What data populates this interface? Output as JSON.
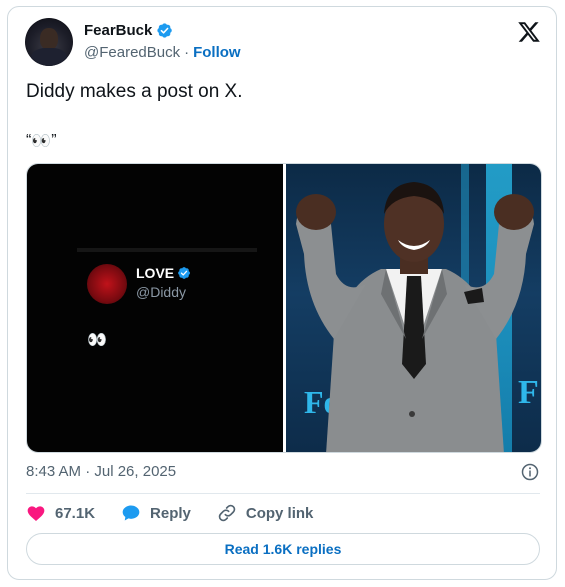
{
  "author": {
    "name": "FearBuck",
    "handle": "@FearedBuck",
    "separator": "·",
    "follow_label": "Follow"
  },
  "tweet": {
    "text": "Diddy makes a post on X.",
    "quote_open": "“",
    "quote_emoji": "👀",
    "quote_close": "”"
  },
  "media": {
    "left_panel": {
      "display_name": "LOVE",
      "handle": "@Diddy",
      "emoji": "👀"
    },
    "right_panel": {
      "stage_text_left": "Fo",
      "stage_text_right": "F"
    }
  },
  "meta": {
    "timestamp": "8:43 AM · Jul 26, 2025"
  },
  "actions": {
    "likes": "67.1K",
    "reply_label": "Reply",
    "copy_label": "Copy link"
  },
  "read_replies_label": "Read 1.6K replies",
  "colors": {
    "accent": "#0a6fc2",
    "verified": "#1d9bf0",
    "like": "#f91880",
    "muted": "#536471"
  }
}
